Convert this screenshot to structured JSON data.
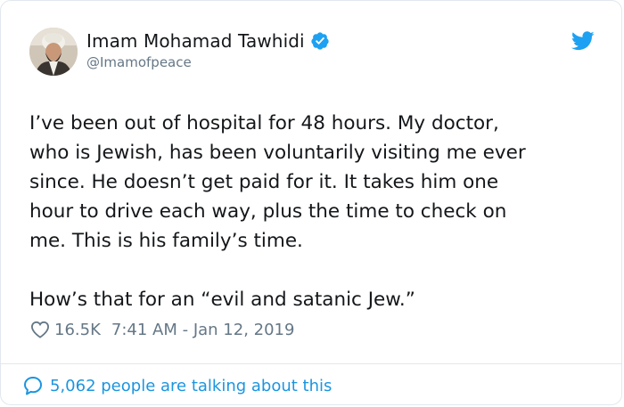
{
  "user": {
    "display_name": "Imam Mohamad Tawhidi",
    "handle": "@Imamofpeace",
    "verified": true
  },
  "tweet": {
    "text": "I’ve been out of hospital for 48 hours. My doctor,\nwho is Jewish, has been voluntarily visiting me ever\nsince. He doesn’t get paid for it. It takes him one\nhour to drive each way, plus the time to check on\nme. This is his family’s time.\n\nHow’s that for an “evil and satanic Jew.”"
  },
  "meta": {
    "likes": "16.5K",
    "timestamp": "7:41 AM - Jan 12, 2019"
  },
  "footer": {
    "conversation_text": "5,062 people are talking about this"
  },
  "colors": {
    "accent": "#1b95e0",
    "twitter_blue": "#1da1f2",
    "text_primary": "#14171a",
    "text_secondary": "#657786",
    "border": "#e1e8ed"
  },
  "icons": {
    "verified": "verified-badge-icon",
    "bird": "twitter-bird-icon",
    "like": "heart-icon",
    "reply": "speech-bubble-icon"
  }
}
